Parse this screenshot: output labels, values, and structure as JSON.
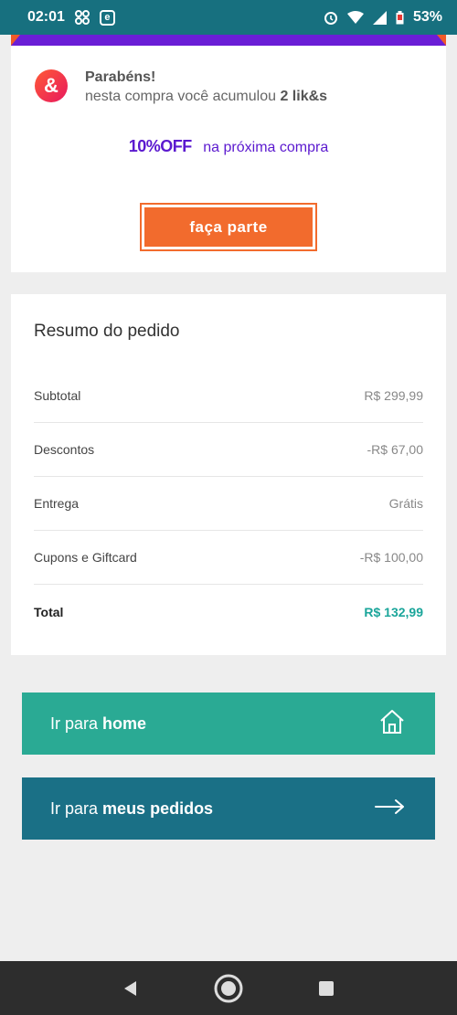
{
  "status_bar": {
    "time": "02:01",
    "battery": "53%"
  },
  "likes": {
    "badge": "&",
    "title": "Parabéns!",
    "text_prefix": "nesta compra você acumulou",
    "likes_amount": "2 lik&s",
    "discount_strong": "10%OFF",
    "discount_text": "na próxima compra",
    "join_label": "faça parte"
  },
  "summary": {
    "title": "Resumo do pedido",
    "rows": [
      {
        "label": "Subtotal",
        "value": "R$ 299,99"
      },
      {
        "label": "Descontos",
        "value": "-R$ 67,00"
      },
      {
        "label": "Entrega",
        "value": "Grátis"
      },
      {
        "label": "Cupons e Giftcard",
        "value": "-R$ 100,00"
      }
    ],
    "total": {
      "label": "Total",
      "value": "R$ 132,99"
    }
  },
  "actions": {
    "home": {
      "prefix": "Ir para",
      "strong": "home",
      "icon": "home-icon"
    },
    "orders": {
      "prefix": "Ir para",
      "strong": "meus pedidos",
      "icon": "arrow-right-icon"
    }
  },
  "colors": {
    "status_bar": "#17707f",
    "accent_purple": "#5b19cf",
    "orange": "#f26b2d",
    "teal_button": "#2aaa94",
    "blue_button": "#1a7086",
    "total_green": "#1aa59a"
  }
}
